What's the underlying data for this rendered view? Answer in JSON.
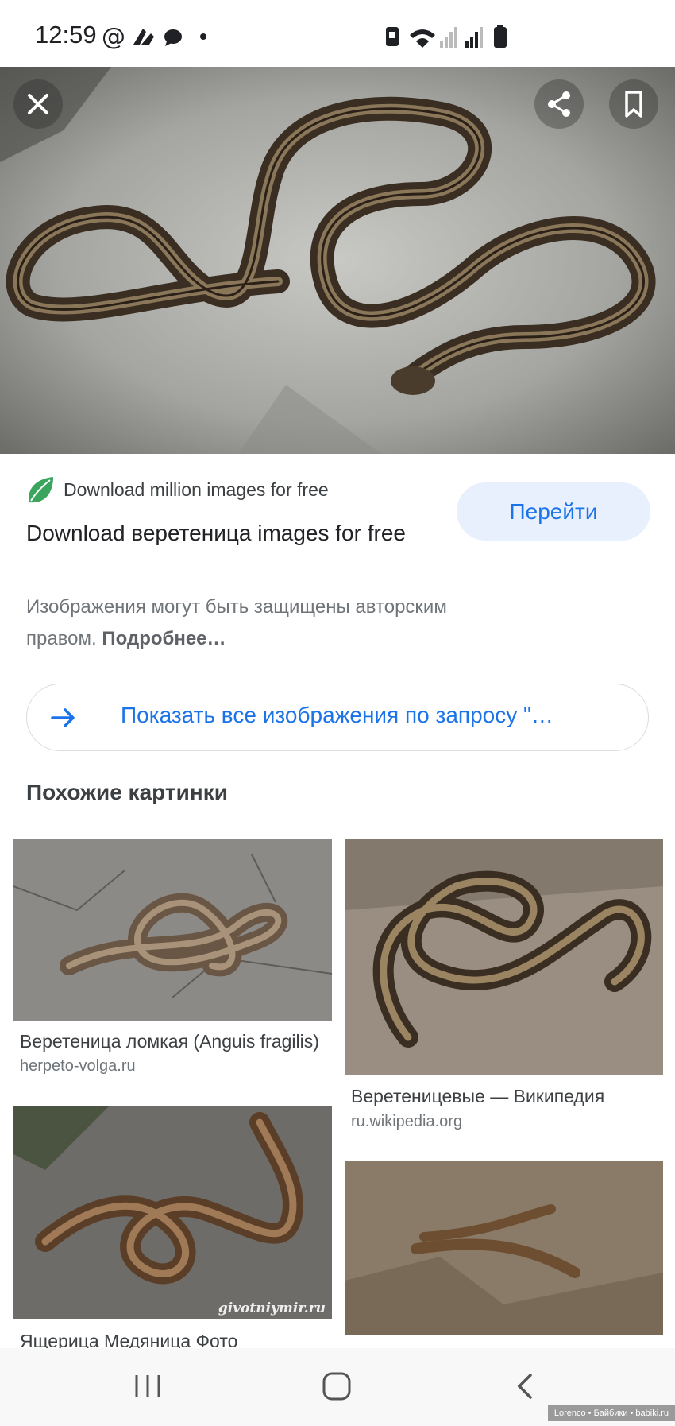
{
  "status_bar": {
    "time": "12:59"
  },
  "ad": {
    "site_name": "Download million images for free",
    "title": "Download веретеница images for free",
    "go_button": "Перейти",
    "copyright_text": "Изображения могут быть защищены авторским правом.",
    "copyright_more": "Подробнее…",
    "show_all": "Показать все изображения по запросу \"…"
  },
  "similar": {
    "heading": "Похожие картинки",
    "items": [
      {
        "title": "Веретеница ломкая (Anguis fragilis)",
        "source": "herpeto-volga.ru"
      },
      {
        "title": "Веретеницевые — Википедия",
        "source": "ru.wikipedia.org"
      },
      {
        "title": "Ящерица Медяница Фото",
        "source": ""
      },
      {
        "title": "",
        "source": ""
      }
    ],
    "image_watermark": "givotniymir.ru"
  },
  "watermark": "Lorenco • Байбики • babiki.ru",
  "colors": {
    "accent": "#1a73e8",
    "button_bg": "#e8f0fe"
  },
  "icons": [
    "close-icon",
    "share-icon",
    "bookmark-icon",
    "arrow-right-icon",
    "leaf-logo-icon",
    "recents-icon",
    "home-icon",
    "back-icon"
  ]
}
